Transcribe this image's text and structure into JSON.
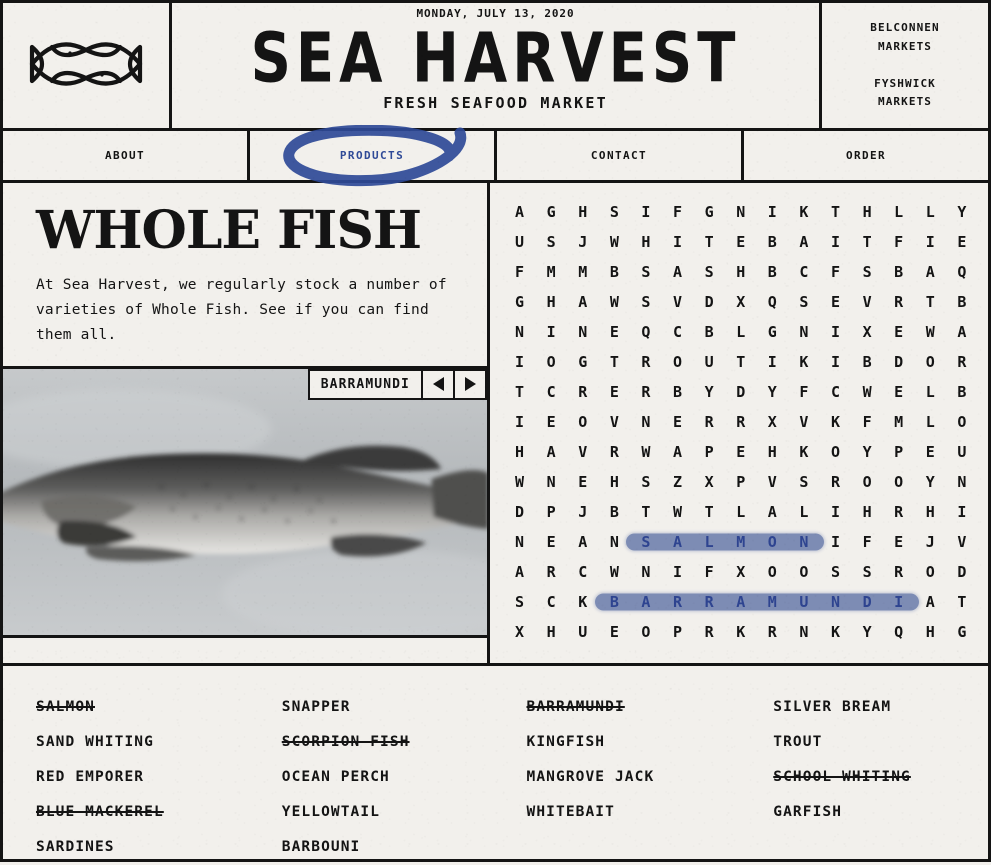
{
  "colors": {
    "paper": "#f2f0ec",
    "ink": "#141414",
    "accent_blue": "#2f4a97",
    "highlight_blue": "#51679f"
  },
  "header": {
    "date": "MONDAY, JULY 13, 2020",
    "title": "SEA HARVEST",
    "subtitle": "FRESH SEAFOOD MARKET",
    "logo_icon": "two-fish-knot-logo",
    "markets": [
      "BELCONNEN\nMARKETS",
      "FYSHWICK\nMARKETS"
    ],
    "market_lines": [
      [
        "BELCONNEN",
        "MARKETS"
      ],
      [
        "FYSHWICK",
        "MARKETS"
      ]
    ]
  },
  "nav": {
    "items": [
      {
        "label": "ABOUT",
        "active": false
      },
      {
        "label": "PRODUCTS",
        "active": true
      },
      {
        "label": "CONTACT",
        "active": false
      },
      {
        "label": "ORDER",
        "active": false
      }
    ]
  },
  "main": {
    "page_title": "WHOLE FISH",
    "intro": "At Sea Harvest, we regularly stock a number of varieties of Whole Fish. See if you can find them all.",
    "carousel": {
      "current_label": "BARRAMUNDI",
      "prev_icon": "triangle-left-icon",
      "next_icon": "triangle-right-icon",
      "photo_alt": "barramundi-fish-photo"
    }
  },
  "wordsearch": {
    "rows": [
      "AGHSIFGNIKTHLLY",
      "USJWHITEBAITFIE",
      "FMMBSASHBCFSBAQ",
      "GHAWSVDXQSEVRTB",
      "NINEQCBLGNIXEWA",
      "IOGTROUTIKIBDOR",
      "TCRERBYDYFCWELB",
      "IEOVNERRXVKFMLO",
      "HAVRWAPEHKOYPEU",
      "WNEHSZXPVSROOYN",
      "DPJBTWTLALIHRHI",
      "NEANSALMONIFEJV",
      "ARCWNIFXOOSSROD",
      "SCKBARRAMUNDIAT",
      "XHUEOPRKRNKYQHG"
    ],
    "found_words": [
      {
        "word": "SALMON",
        "row": 11,
        "col_start": 4,
        "col_end": 9
      },
      {
        "word": "BARRAMUNDI",
        "row": 13,
        "col_start": 3,
        "col_end": 12
      }
    ]
  },
  "word_list": {
    "columns": [
      [
        {
          "label": "SALMON",
          "found": true
        },
        {
          "label": "SAND WHITING",
          "found": false
        },
        {
          "label": "RED EMPORER",
          "found": false
        },
        {
          "label": "BLUE MACKEREL",
          "found": true
        },
        {
          "label": "SARDINES",
          "found": false
        }
      ],
      [
        {
          "label": "SNAPPER",
          "found": false
        },
        {
          "label": "SCORPION FISH",
          "found": true
        },
        {
          "label": "OCEAN PERCH",
          "found": false
        },
        {
          "label": "YELLOWTAIL",
          "found": false
        },
        {
          "label": "BARBOUNI",
          "found": false
        }
      ],
      [
        {
          "label": "BARRAMUNDI",
          "found": true
        },
        {
          "label": "KINGFISH",
          "found": false
        },
        {
          "label": "MANGROVE JACK",
          "found": false
        },
        {
          "label": "WHITEBAIT",
          "found": false
        }
      ],
      [
        {
          "label": "SILVER BREAM",
          "found": false
        },
        {
          "label": "TROUT",
          "found": false
        },
        {
          "label": "SCHOOL WHITING",
          "found": true
        },
        {
          "label": "GARFISH",
          "found": false
        }
      ]
    ]
  }
}
